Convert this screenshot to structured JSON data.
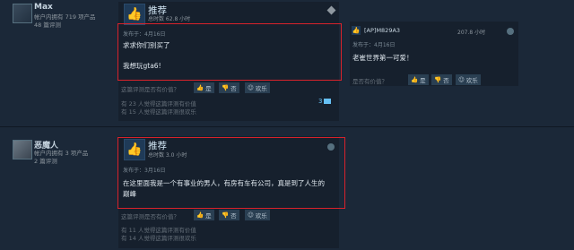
{
  "review1": {
    "username": "Max",
    "owned": "帐户内拥有 719 项产品",
    "reviews": "48 篇评测",
    "recommend": "推荐",
    "hours": "总时数 62.8 小时",
    "posted": "发布于：4月16日",
    "text_line1": "求求你们别买了",
    "text_line2": "我想玩gta6!",
    "helpful_q": "这篇评测是否有价值？",
    "btn_yes": "是",
    "btn_no": "否",
    "btn_funny": "欢乐",
    "stat1": "有 23 人觉得这篇评测有价值",
    "stat2": "有 15 人觉得这篇评测很欢乐",
    "comments": "3"
  },
  "review_right": {
    "username": "[AP]M829A3",
    "hours": "207.8 小时",
    "posted": "发布于：4月16日",
    "text": "老崔世界第一可爱！",
    "helpful_q": "是否有价值？",
    "btn_yes": "是",
    "btn_no": "否",
    "btn_funny": "欢乐"
  },
  "review2": {
    "username": "恶魔人",
    "owned": "帐户内拥有 3 项产品",
    "reviews": "2 篇评测",
    "recommend": "推荐",
    "hours": "总时数 3.0 小时",
    "posted": "发布于：3月16日",
    "text_line1": "在这里面我是一个有事业的男人，有房有车有公司，真是到了人生的",
    "text_line2": "巅峰",
    "helpful_q": "这篇评测是否有价值？",
    "btn_yes": "是",
    "btn_no": "否",
    "btn_funny": "欢乐",
    "stat1": "有 11 人觉得这篇评测有价值",
    "stat2": "有 14 人觉得这篇评测很欢乐"
  },
  "icons": {
    "thumb": "thumbs-up-icon",
    "steam": "steam-icon"
  }
}
